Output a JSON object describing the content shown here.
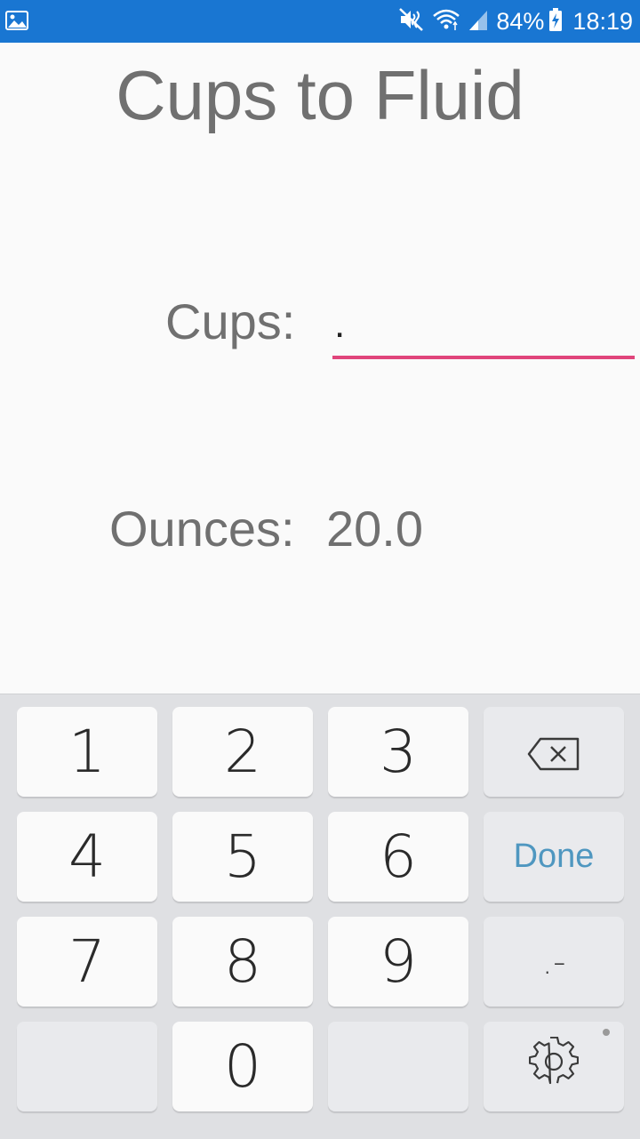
{
  "status_bar": {
    "battery_percent": "84%",
    "time": "18:19"
  },
  "app": {
    "title": "Cups to Fluid",
    "cups_label": "Cups:",
    "cups_value": ".",
    "ounces_label": "Ounces:",
    "ounces_value": "20.0",
    "input_accent_color": "#e0457b"
  },
  "keyboard": {
    "keys": {
      "k1": "1",
      "k2": "2",
      "k3": "3",
      "k4": "4",
      "k5": "5",
      "k6": "6",
      "k7": "7",
      "k8": "8",
      "k9": "9",
      "k0": "0",
      "done": "Done",
      "punct": ".-"
    },
    "icons": {
      "backspace": "backspace-icon",
      "settings": "gear-icon"
    }
  }
}
